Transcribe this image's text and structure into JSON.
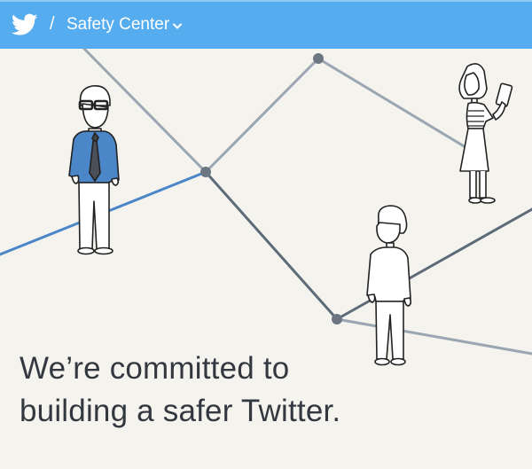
{
  "header": {
    "logo_icon": "twitter-bird-icon",
    "separator": "/",
    "section_title": "Safety Center",
    "dropdown_icon": "chevron-down-icon",
    "bar_color": "#55acee"
  },
  "hero": {
    "headline_line1": "We’re committed to",
    "headline_line2": "building a safer Twitter.",
    "accent_line_color": "#4a86c8",
    "illustration": "people-network-illustration"
  }
}
